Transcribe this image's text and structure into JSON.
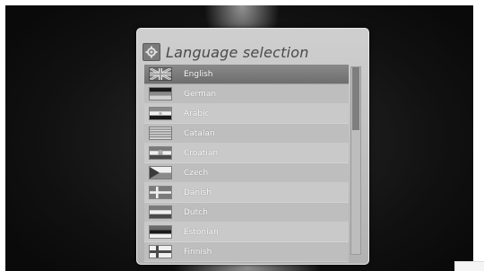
{
  "dialog": {
    "title": "Language selection",
    "title_icon": "gear-icon"
  },
  "languages": [
    {
      "label": "English",
      "flag": "uk-flag-icon",
      "selected": true
    },
    {
      "label": "German",
      "flag": "germany-flag-icon"
    },
    {
      "label": "Arabic",
      "flag": "arabic-flag-icon"
    },
    {
      "label": "Catalan",
      "flag": "catalonia-flag-icon"
    },
    {
      "label": "Croatian",
      "flag": "croatia-flag-icon"
    },
    {
      "label": "Czech",
      "flag": "czech-flag-icon"
    },
    {
      "label": "Danish",
      "flag": "denmark-flag-icon"
    },
    {
      "label": "Dutch",
      "flag": "netherlands-flag-icon"
    },
    {
      "label": "Estonian",
      "flag": "estonia-flag-icon"
    },
    {
      "label": "Finnish",
      "flag": "finland-flag-icon"
    }
  ],
  "colors": {
    "panel": "#c4c4c4",
    "selected_row": "#7a7a7a",
    "background": "#151515"
  }
}
